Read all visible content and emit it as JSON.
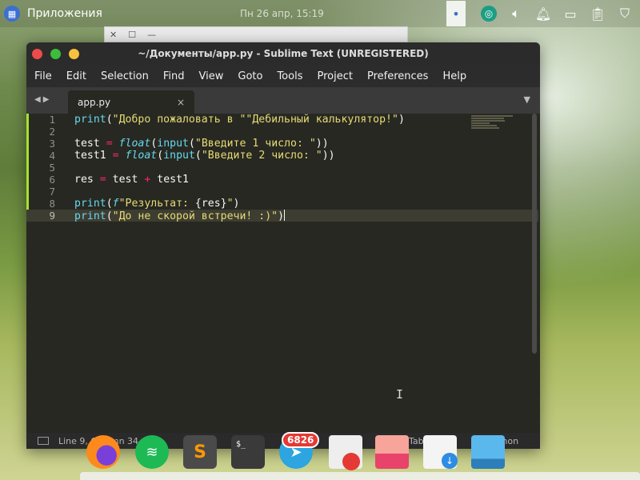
{
  "top_panel": {
    "apps_label": "Приложения",
    "clock": "Пн 26 апр, 15:19",
    "tray_icons": [
      "dot-icon",
      "app-indicator-icon",
      "volume-icon",
      "notification-bell-icon",
      "display-icon",
      "clipboard-icon",
      "shield-icon"
    ]
  },
  "window": {
    "title": "~/Документы/app.py - Sublime Text (UNREGISTERED)",
    "menu": [
      "File",
      "Edit",
      "Selection",
      "Find",
      "View",
      "Goto",
      "Tools",
      "Project",
      "Preferences",
      "Help"
    ],
    "tab": {
      "label": "app.py",
      "close": "×"
    },
    "code_lines": [
      {
        "n": "1",
        "tokens": [
          [
            "fn",
            "print"
          ],
          [
            "pl",
            "("
          ],
          [
            "str",
            "\"Добро пожаловать в \"\"Дебильный калькулятор!\""
          ],
          [
            "pl",
            ")"
          ]
        ]
      },
      {
        "n": "2",
        "tokens": []
      },
      {
        "n": "3",
        "tokens": [
          [
            "pl",
            "test "
          ],
          [
            "op",
            "="
          ],
          [
            "pl",
            " "
          ],
          [
            "fni",
            "float"
          ],
          [
            "pl",
            "("
          ],
          [
            "fn",
            "input"
          ],
          [
            "pl",
            "("
          ],
          [
            "str",
            "\"Введите 1 число: \""
          ],
          [
            "pl",
            "))"
          ]
        ]
      },
      {
        "n": "4",
        "tokens": [
          [
            "pl",
            "test1 "
          ],
          [
            "op",
            "="
          ],
          [
            "pl",
            " "
          ],
          [
            "fni",
            "float"
          ],
          [
            "pl",
            "("
          ],
          [
            "fn",
            "input"
          ],
          [
            "pl",
            "("
          ],
          [
            "str",
            "\"Введите 2 число: \""
          ],
          [
            "pl",
            "))"
          ]
        ]
      },
      {
        "n": "5",
        "tokens": []
      },
      {
        "n": "6",
        "tokens": [
          [
            "pl",
            "res "
          ],
          [
            "op",
            "="
          ],
          [
            "pl",
            " test "
          ],
          [
            "op",
            "+"
          ],
          [
            "pl",
            " test1"
          ]
        ]
      },
      {
        "n": "7",
        "tokens": []
      },
      {
        "n": "8",
        "tokens": [
          [
            "fn",
            "print"
          ],
          [
            "pl",
            "("
          ],
          [
            "fni",
            "f"
          ],
          [
            "str",
            "\"Результат: "
          ],
          [
            "pl",
            "{res}"
          ],
          [
            "str",
            "\""
          ],
          [
            "pl",
            ")"
          ]
        ]
      },
      {
        "n": "9",
        "tokens": [
          [
            "fn",
            "print"
          ],
          [
            "pl",
            "("
          ],
          [
            "str",
            "\"До не скорой встречи! :)\""
          ],
          [
            "pl",
            ")"
          ]
        ]
      }
    ],
    "current_line": "9",
    "status": {
      "position": "Line 9, Column 34",
      "tab_size": "Tab Size: 4",
      "syntax": "Python"
    }
  },
  "background_window": {
    "close": "✕",
    "maximize": "☐",
    "minimize": "—"
  },
  "dock": {
    "items": [
      "firefox-icon",
      "spotify-icon",
      "sublime-text-icon",
      "terminal-icon",
      "telegram-icon",
      "text-editor-icon",
      "photos-icon",
      "software-store-icon",
      "files-icon"
    ],
    "telegram_badge": "6826",
    "terminal_prompt": "$_"
  }
}
